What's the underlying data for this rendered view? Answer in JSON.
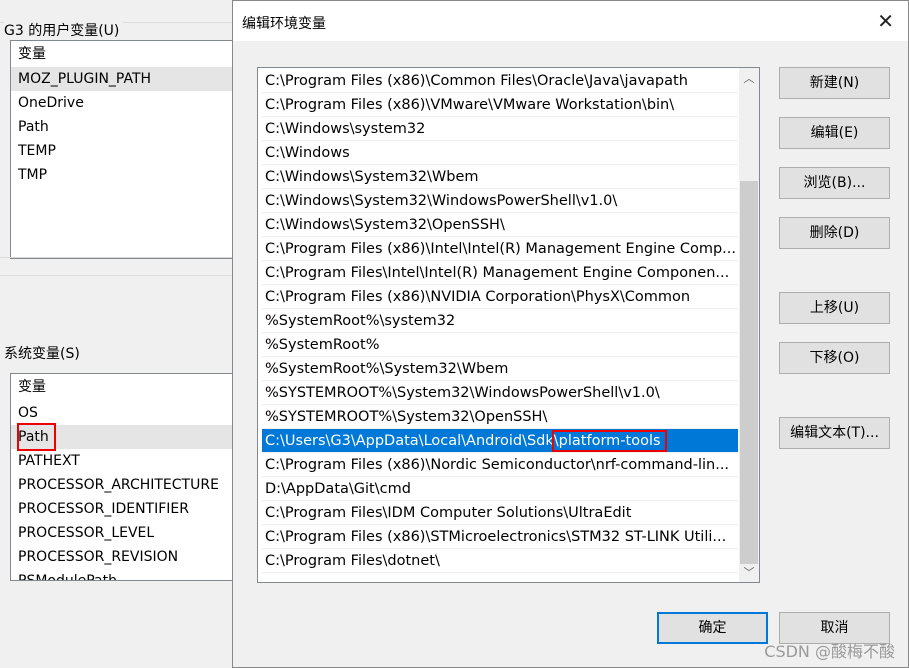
{
  "background": {
    "user_group_label": "G3 的用户变量(U)",
    "user_header": "变量",
    "user_vars": [
      "MOZ_PLUGIN_PATH",
      "OneDrive",
      "Path",
      "TEMP",
      "TMP"
    ],
    "system_group_label": "系统变量(S)",
    "system_header": "变量",
    "system_vars": [
      "OS",
      "Path",
      "PATHEXT",
      "PROCESSOR_ARCHITECTURE",
      "PROCESSOR_IDENTIFIER",
      "PROCESSOR_LEVEL",
      "PROCESSOR_REVISION",
      "PSModulePath"
    ]
  },
  "dialog": {
    "title": "编辑环境变量",
    "close_icon": "close-icon",
    "selected_path_prefix": "C:\\Users\\G3\\AppData\\Local\\Android\\Sdk",
    "selected_path_highlight": "\\platform-tools",
    "paths": [
      "C:\\Program Files (x86)\\Common Files\\Oracle\\Java\\javapath",
      "C:\\Program Files (x86)\\VMware\\VMware Workstation\\bin\\",
      "C:\\Windows\\system32",
      "C:\\Windows",
      "C:\\Windows\\System32\\Wbem",
      "C:\\Windows\\System32\\WindowsPowerShell\\v1.0\\",
      "C:\\Windows\\System32\\OpenSSH\\",
      "C:\\Program Files (x86)\\Intel\\Intel(R) Management Engine Comp...",
      "C:\\Program Files\\Intel\\Intel(R) Management Engine Componen...",
      "C:\\Program Files (x86)\\NVIDIA Corporation\\PhysX\\Common",
      "%SystemRoot%\\system32",
      "%SystemRoot%",
      "%SystemRoot%\\System32\\Wbem",
      "%SYSTEMROOT%\\System32\\WindowsPowerShell\\v1.0\\",
      "%SYSTEMROOT%\\System32\\OpenSSH\\",
      "C:\\Users\\G3\\AppData\\Local\\Android\\Sdk\\platform-tools",
      "C:\\Program Files (x86)\\Nordic Semiconductor\\nrf-command-lin...",
      "D:\\AppData\\Git\\cmd",
      "C:\\Program Files\\IDM Computer Solutions\\UltraEdit",
      "C:\\Program Files (x86)\\STMicroelectronics\\STM32 ST-LINK Utili...",
      "C:\\Program Files\\dotnet\\"
    ],
    "selected_index": 15,
    "buttons": {
      "new": "新建(N)",
      "edit": "编辑(E)",
      "browse": "浏览(B)...",
      "delete": "删除(D)",
      "move_up": "上移(U)",
      "move_down": "下移(O)",
      "edit_text": "编辑文本(T)...",
      "ok": "确定",
      "cancel": "取消"
    },
    "highlight_color": "#0078d7",
    "annotation_color": "#e00000"
  },
  "watermark": "CSDN @酸梅不酸"
}
